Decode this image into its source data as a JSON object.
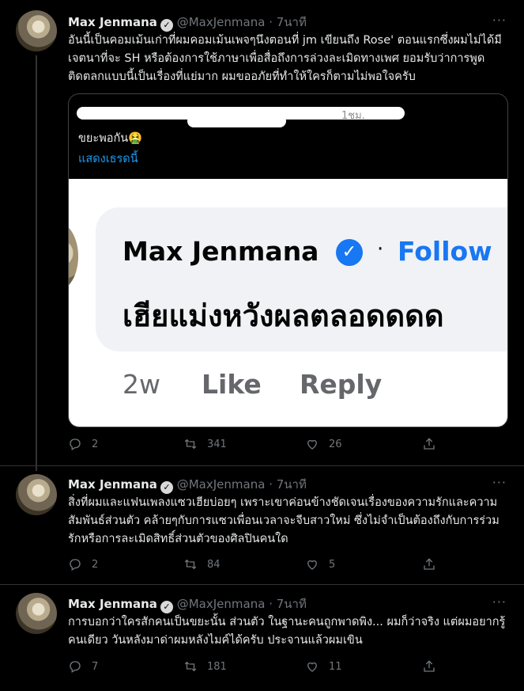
{
  "tweets": [
    {
      "name": "Max Jenmana",
      "handle": "@MaxJenmana",
      "dot": "·",
      "time": "7นาที",
      "more": "···",
      "text": "อันนี้เป็นคอมเม้นเก่าที่ผมคอมเม้นเพจๆนึงตอนที่ jm เขียนถึง Rose' ตอนแรกซึ่งผมไม่ได้มีเจตนาที่จะ SH หรือต้องการใช้ภาษาเพื่อสื่อถึงการล่วงละเมิดทางเพศ ยอมรับว่าการพูดติดตลกแบบนี้เป็นเรื่องที่แย่มาก ผมขออภัยที่ทำให้ใครก็ตามไม่พอใจครับ",
      "replies": "2",
      "retweets": "341",
      "likes": "26"
    },
    {
      "name": "Max Jenmana",
      "handle": "@MaxJenmana",
      "dot": "·",
      "time": "7นาที",
      "more": "···",
      "text": "สิ่งที่ผมและแฟนเพลงแซวเฮียบ่อยๆ เพราะเขาค่อนข้างชัดเจนเรื่องของความรักและความสัมพันธ์ส่วนตัว คล้ายๆกับการแซวเพื่อนเวลาจะจีบสาวใหม่ ซึ่งไม่จำเป็นต้องถึงกับการร่วมรักหรือการละเมิดสิทธิ์ส่วนตัวของศิลปินคนใด",
      "replies": "2",
      "retweets": "84",
      "likes": "5"
    },
    {
      "name": "Max Jenmana",
      "handle": "@MaxJenmana",
      "dot": "·",
      "time": "7นาที",
      "more": "···",
      "text": "การบอกว่าใครสักคนเป็นขยะนั้น ส่วนตัว ในฐานะคนถูกพาดพิง... ผมก็ว่าจริง แต่ผมอยากรู้คนเดียว วันหลังมาด่าผมหลังไมค์ได้ครับ ประจานแล้วผมเขิน",
      "replies": "7",
      "retweets": "181",
      "likes": "11"
    }
  ],
  "quote": {
    "time": "1ชม.",
    "text": "ขยะพอกัน🤮",
    "show_thread": "แสดงเธรดนี้",
    "fb": {
      "name": "Max Jenmana",
      "check": "✓",
      "dot": "·",
      "follow": "Follow",
      "comment": "เฮียแม่งหวังผลตลอดดดด",
      "age": "2w",
      "like": "Like",
      "reply": "Reply"
    }
  }
}
